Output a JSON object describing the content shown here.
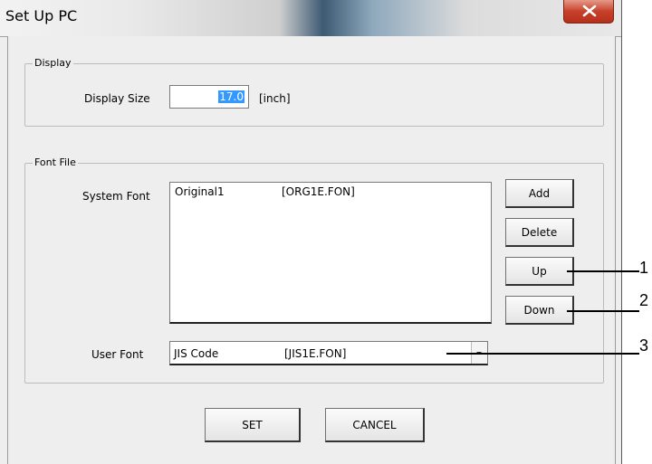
{
  "window": {
    "title": "Set Up PC",
    "close_icon": "close-x-icon"
  },
  "display_group": {
    "legend": "Display",
    "size_label": "Display Size",
    "size_value": "17.0",
    "size_unit": "[inch]"
  },
  "font_group": {
    "legend": "Font File",
    "system_font_label": "System Font",
    "system_font_items": [
      {
        "name": "Original1",
        "file": "[ORG1E.FON]"
      }
    ],
    "user_font_label": "User Font",
    "user_font_name": "JIS Code",
    "user_font_file": "[JIS1E.FON]",
    "buttons": {
      "add": "Add",
      "delete": "Delete",
      "up": "Up",
      "down": "Down"
    }
  },
  "footer": {
    "set": "SET",
    "cancel": "CANCEL"
  },
  "callouts": [
    "1",
    "2",
    "3"
  ]
}
